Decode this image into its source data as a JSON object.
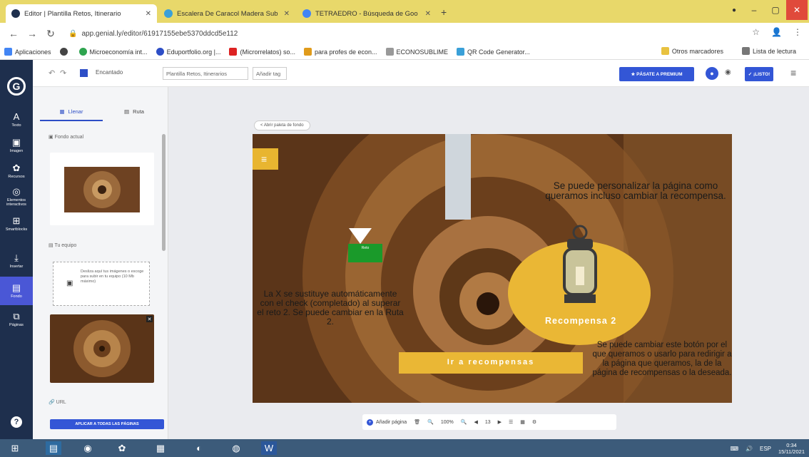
{
  "browser": {
    "tabs": [
      {
        "title": "Editor | Plantilla Retos, Itinerario",
        "active": true,
        "favicon_color": "#1e2f4d"
      },
      {
        "title": "Escalera De Caracol Madera Sub",
        "active": false,
        "favicon_color": "#3aa0d8"
      },
      {
        "title": "TETRAEDRO - Búsqueda de Goo",
        "active": false,
        "favicon_color": "#4285f4"
      }
    ],
    "new_tab_icon": "+",
    "url": "app.genial.ly/editor/61917155ebe5370ddcd5e112",
    "bookmarks": [
      {
        "label": "Aplicaciones",
        "color": "#4285f4"
      },
      {
        "label": "",
        "color": "#444444"
      },
      {
        "label": "Microeconomía int...",
        "color": "#2ea44f"
      },
      {
        "label": "Eduportfolio.org |...",
        "color": "#2d4ec6"
      },
      {
        "label": "(Microrrelatos) so...",
        "color": "#d22"
      },
      {
        "label": "para profes de econ...",
        "color": "#e09b1b"
      },
      {
        "label": "ECONOSUBLIME",
        "color": "#999999"
      },
      {
        "label": "QR Code Generator...",
        "color": "#3aa0d8"
      }
    ],
    "bookmarks_right": [
      "Otros marcadores",
      "Lista de lectura"
    ]
  },
  "toolbar": {
    "undo": "↶",
    "redo": "↷",
    "theme_label": "Encantado",
    "title_field": "Plantilla Retos, Itinerarios",
    "tag_field": "Añadir tag",
    "premium_button": "★ PÁSATE A PREMIUM",
    "listo_button": "✓ ¡LISTO!"
  },
  "rail": [
    {
      "icon": "A",
      "label": "Texto"
    },
    {
      "icon": "▣",
      "label": "Imagen"
    },
    {
      "icon": "✿",
      "label": "Recursos"
    },
    {
      "icon": "◎",
      "label": "Elementos interactivos"
    },
    {
      "icon": "⊞",
      "label": "Smartblocks"
    },
    {
      "icon": "⤓",
      "label": "Insertar"
    },
    {
      "icon": "▤",
      "label": "Fondo",
      "active": true
    },
    {
      "icon": "⧉",
      "label": "Páginas"
    }
  ],
  "panel": {
    "tab_color": "Llenar",
    "tab_image": "Ruta",
    "section_current": "Fondo actual",
    "section_upload": "Tu equipo",
    "upload_text": "Desliza aquí tus imágenes o escoge para subir en tu equipo (10 Mb máximo)",
    "section_url": "URL",
    "apply_button": "APLICAR A TODAS LAS PÁGINAS"
  },
  "canvas": {
    "back_link": "< Abrir paleta de fondo",
    "note_top": "Se puede personalizar la página como queramos incluso cambiar la recompensa.",
    "note_left": "La X se sustituye automáticamente con el check (completado) al superar el reto 2. Se puede cambiar en la Ruta 2.",
    "green_button_text": "Reto",
    "reward_label": "Recompensa 2",
    "go_button": "Ir a recompensas",
    "note_bottom": "Se puede cambiar este botón por el que queramos o usarlo para redirigir a la página que queramos, la de la página de recompensas o la deseada."
  },
  "bottombar": {
    "add_page": "Añadir página",
    "zoom": "100%",
    "page_counter": "13"
  },
  "taskbar": {
    "language": "ESP",
    "time": "0:34",
    "date": "15/11/2021"
  }
}
